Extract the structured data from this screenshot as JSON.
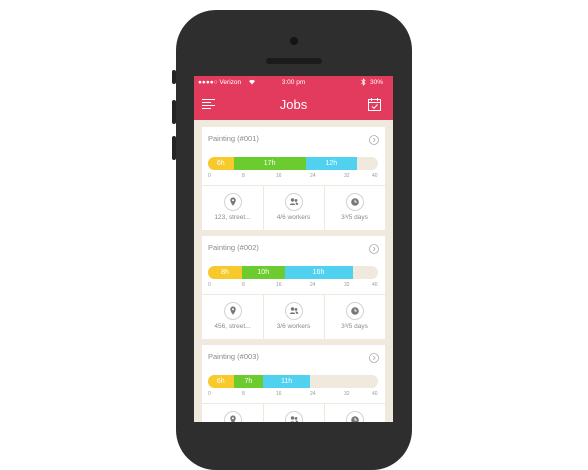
{
  "status_bar": {
    "carrier": "●●●●○ Verizon",
    "time": "3:00 pm",
    "battery": "30%"
  },
  "nav": {
    "title": "Jobs",
    "left_icon": "menu-icon",
    "right_icon": "calendar-icon"
  },
  "colors": {
    "accent": "#e23b5d",
    "yellow": "#f7c92b",
    "green": "#6ccb2e",
    "blue": "#4fd1ef",
    "track": "#efe9de"
  },
  "ticks": [
    "0",
    "8",
    "16",
    "24",
    "32",
    "40"
  ],
  "jobs": [
    {
      "title": "Painting (#001)",
      "segments": [
        {
          "label": "6h",
          "hours": 6
        },
        {
          "label": "17h",
          "hours": 17
        },
        {
          "label": "12h",
          "hours": 12
        }
      ],
      "location": "123, street...",
      "workers": "4/6 workers",
      "days": "3³/5 days"
    },
    {
      "title": "Painting (#002)",
      "segments": [
        {
          "label": "8h",
          "hours": 8
        },
        {
          "label": "10h",
          "hours": 10
        },
        {
          "label": "16h",
          "hours": 16
        }
      ],
      "location": "456, street...",
      "workers": "3/6 workers",
      "days": "3³/5 days"
    },
    {
      "title": "Painting (#003)",
      "segments": [
        {
          "label": "6h",
          "hours": 6
        },
        {
          "label": "7h",
          "hours": 7
        },
        {
          "label": "11h",
          "hours": 11
        }
      ],
      "location": "",
      "workers": "",
      "days": ""
    }
  ]
}
